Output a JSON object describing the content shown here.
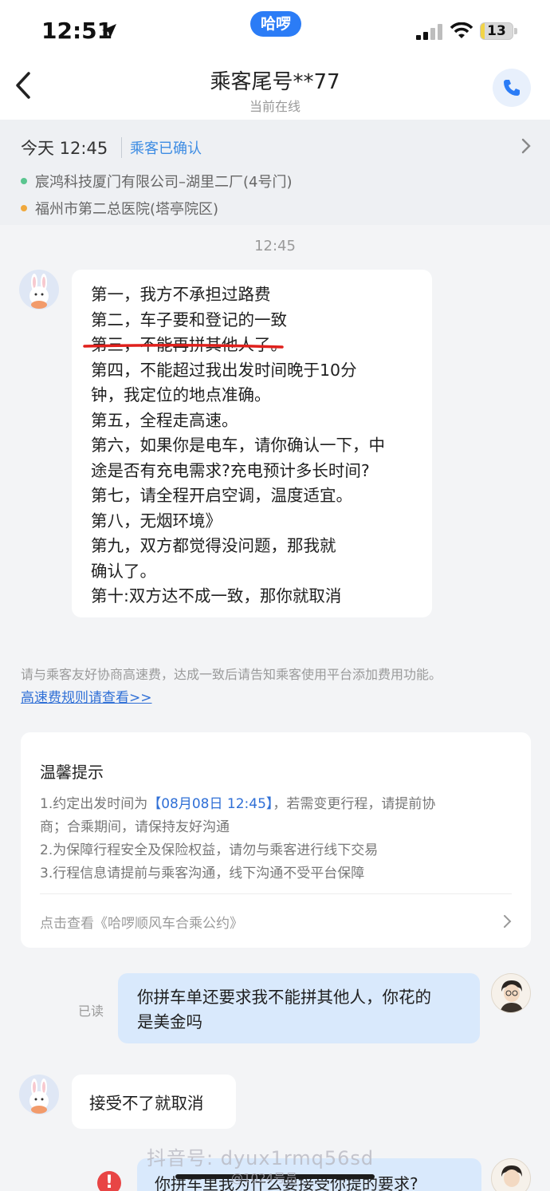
{
  "status_bar": {
    "time": "12:51",
    "app_badge": "哈啰",
    "battery": "13",
    "battery_level": 0.13
  },
  "header": {
    "title": "乘客尾号**77",
    "subtitle": "当前在线"
  },
  "trip": {
    "time": "今天 12:45",
    "status": "乘客已确认",
    "origin": "宸鸿科技厦门有限公司–湖里二厂(4号门)",
    "destination": "福州市第二总医院(塔亭院区)"
  },
  "chat": {
    "timestamp": "12:45",
    "rules": [
      "第一，我方不承担过路费",
      "第二，车子要和登记的一致",
      "第三，不能再拼其他人了。",
      "第四，不能超过我出发时间晚于10分",
      "钟，我定位的地点准确。",
      "第五，全程走高速。",
      "第六，如果你是电车，请你确认一下，中",
      "途是否有充电需求?充电预计多长时间?",
      "第七，请全程开启空调，温度适宜。",
      "第八，无烟环境》",
      "第九，双方都觉得没问题，那我就",
      "确认了。",
      "第十:双方达不成一致，那你就取消"
    ],
    "notice": "请与乘客友好协商高速费，达成一致后请告知乘客使用平台添加费用功能。",
    "notice_link": "高速费规则请查看>>",
    "tips": {
      "title": "温馨提示",
      "line1_prefix": "1.约定出发时间为",
      "line1_highlight": "【08月08日 12:45】",
      "line1_suffix": "，若需变更行程，请提前协",
      "line1_cont": "商；合乘期间，请保持友好沟通",
      "line2": "2.为保障行程安全及保险权益，请勿与乘客进行线下交易",
      "line3": "3.行程信息请提前与乘客沟通，线下沟通不受平台保障",
      "link": "点击查看《哈啰顺风车合乘公约》"
    },
    "read_label": "已读",
    "my_message_line1": "你拼车单还要求我不能拼其他人，你花的",
    "my_message_line2": "是美金吗",
    "reply": "接受不了就取消",
    "cut_message": "你拼车里我为什么要接受你提的要求?",
    "error_icon": "!"
  },
  "watermarks": {
    "douyin": "抖音号: dyux1rmq56sd",
    "weibo": "@1024号员"
  },
  "colors": {
    "accent": "#2b7cf6",
    "link": "#2f6fd6",
    "bubble_mine": "#d9e9fc",
    "underline": "#e0201c",
    "error": "#e84545"
  }
}
